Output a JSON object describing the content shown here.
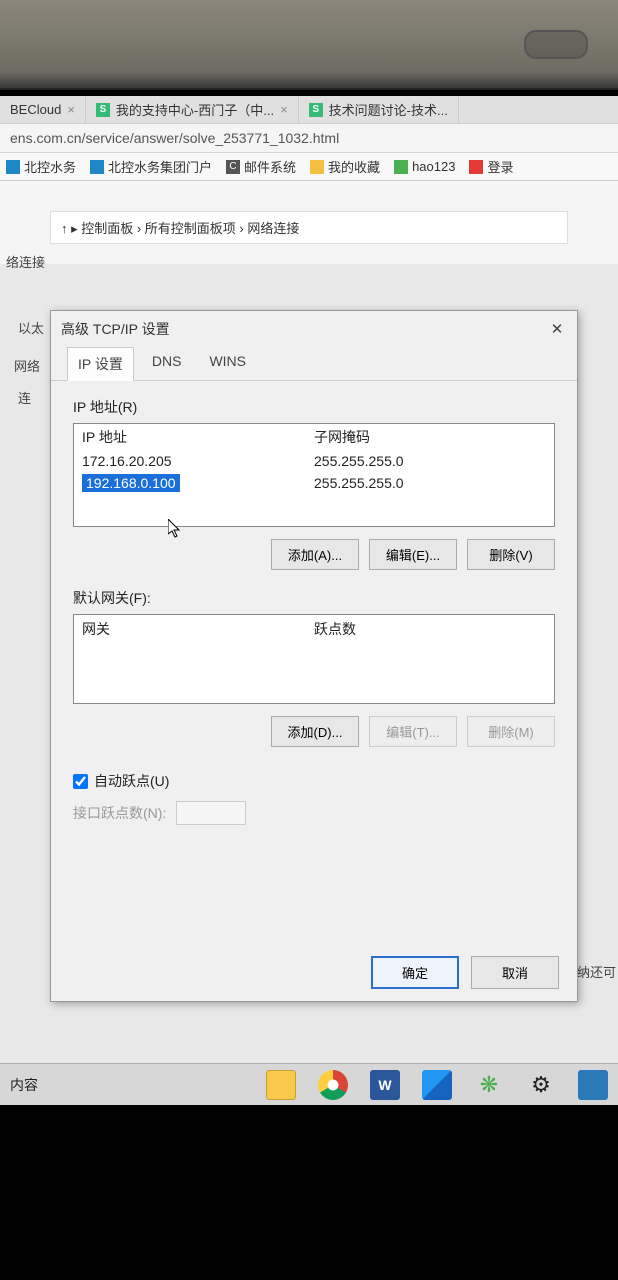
{
  "browser": {
    "tabs": [
      {
        "title": "BECloud"
      },
      {
        "title": "我的支持中心-西门子（中..."
      },
      {
        "title": "技术问题讨论-技术..."
      }
    ],
    "url": "ens.com.cn/service/answer/solve_253771_1032.html",
    "bookmarks": {
      "bk1": "北控水务",
      "bk2": "北控水务集团门户",
      "bk3": "邮件系统",
      "bk4": "我的收藏",
      "bk5": "hao123",
      "bk6": "登录"
    },
    "breadcrumb": "↑  ▸  控制面板 › 所有控制面板项 › 网络连接",
    "sidebar": {
      "title": "网络",
      "item": "连"
    },
    "bgtext1": "络连接",
    "bgtext2": "以太"
  },
  "dialog": {
    "title": "高级 TCP/IP 设置",
    "tabs": {
      "ip": "IP 设置",
      "dns": "DNS",
      "wins": "WINS"
    },
    "ip_section": {
      "label": "IP 地址(R)",
      "col1": "IP 地址",
      "col2": "子网掩码",
      "row1": {
        "ip": "172.16.20.205",
        "mask": "255.255.255.0"
      },
      "row2": {
        "ip": "192.168.0.100",
        "mask": "255.255.255.0"
      },
      "add": "添加(A)...",
      "edit": "编辑(E)...",
      "del": "删除(V)"
    },
    "gateway_section": {
      "label": "默认网关(F):",
      "col1": "网关",
      "col2": "跃点数",
      "add": "添加(D)...",
      "edit": "编辑(T)...",
      "del": "删除(M)"
    },
    "auto_metric": "自动跃点(U)",
    "iface_metric": "接口跃点数(N):",
    "ok": "确定",
    "cancel": "取消"
  },
  "taskbar": {
    "label": "内容",
    "word": "W"
  },
  "bg_right": "纳还可"
}
